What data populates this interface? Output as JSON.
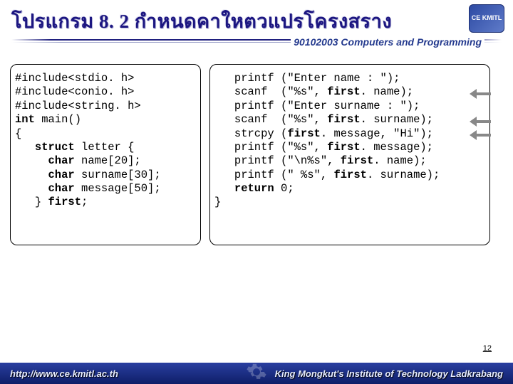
{
  "header": {
    "title": "โปรแกรม  8. 2 กำหนดคาใหตวแปรโครงสราง",
    "subtitle": "90102003 Computers and Programming",
    "logo_text": "CE KMITL"
  },
  "code_left": {
    "l1": "#include<stdio. h>",
    "l2": "#include<conio. h>",
    "l3": "#include<string. h>",
    "l4a": "int",
    "l4b": " main()",
    "l5": "{",
    "l6a": "   struct",
    "l6b": " letter {",
    "l7a": "     char",
    "l7b": " name[20];",
    "l8a": "     char",
    "l8b": " surname[30];",
    "l9a": "     char",
    "l9b": " message[50];",
    "l10a": "   } ",
    "l10b": "first",
    "l10c": ";"
  },
  "code_right": {
    "r1a": "   printf (\"Enter name : \");",
    "r2a": "   scanf  (\"%s\", ",
    "r2b": "first",
    "r2c": ". name);",
    "r3a": "   printf (\"Enter surname : \");",
    "r4a": "   scanf  (\"%s\", ",
    "r4b": "first",
    "r4c": ". surname);",
    "r5a": "   strcpy (",
    "r5b": "first",
    "r5c": ". message, \"Hi\");",
    "r6a": "   printf (\"%s\", ",
    "r6b": "first",
    "r6c": ". message);",
    "r7a": "   printf (\"\\n%s\", ",
    "r7b": "first",
    "r7c": ". name);",
    "r8a": "   printf (\" %s\", ",
    "r8b": "first",
    "r8c": ". surname);",
    "r9a": "   return",
    "r9b": " 0;",
    "r10": "}"
  },
  "page_number": "12",
  "footer": {
    "url": "http://www.ce.kmitl.ac.th",
    "institute": "King Mongkut's Institute of Technology Ladkrabang"
  }
}
